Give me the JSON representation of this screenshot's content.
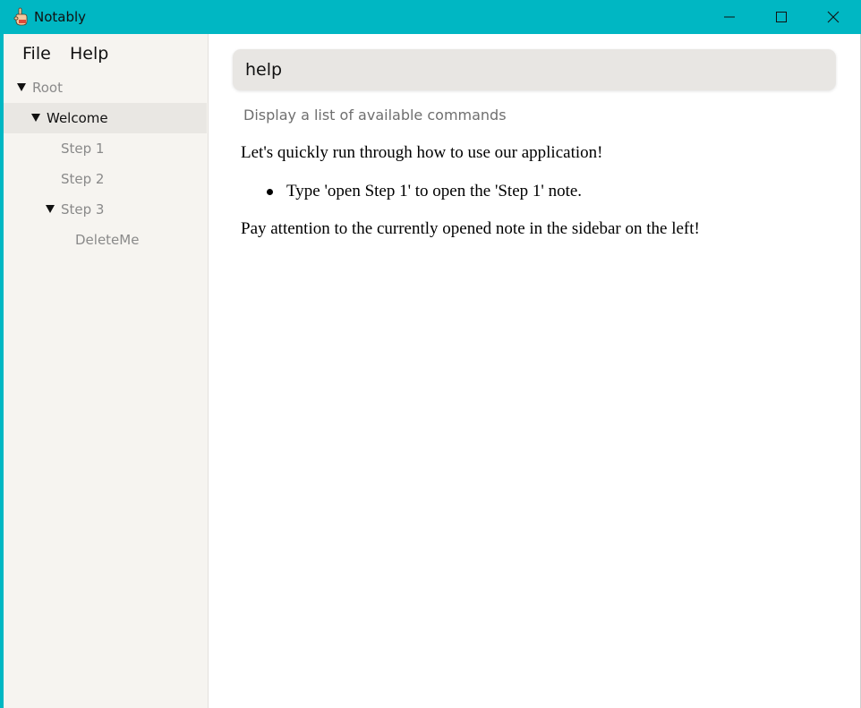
{
  "window": {
    "title": "Notably",
    "accent_color": "#00b7c3",
    "controls": [
      "minimize-icon",
      "maximize-icon",
      "close-icon"
    ]
  },
  "menu": {
    "file_label": "File",
    "help_label": "Help"
  },
  "sidebar": {
    "tree": [
      {
        "label": "Root",
        "expanded": true,
        "selected": false
      },
      {
        "label": "Welcome",
        "expanded": true,
        "selected": true
      },
      {
        "label": "Step 1",
        "expanded": false,
        "selected": false
      },
      {
        "label": "Step 2",
        "expanded": false,
        "selected": false
      },
      {
        "label": "Step 3",
        "expanded": true,
        "selected": false
      },
      {
        "label": "DeleteMe",
        "expanded": false,
        "selected": false
      }
    ]
  },
  "command": {
    "value": "help",
    "hint": "Display a list of available commands"
  },
  "note": {
    "intro": "Let's quickly run through how to use our application!",
    "bullets": [
      "Type 'open Step 1' to open the 'Step 1' note."
    ],
    "outro": "Pay attention to the currently opened note in the sidebar on the left!"
  }
}
